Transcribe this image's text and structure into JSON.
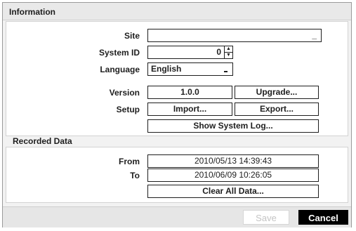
{
  "info": {
    "title": "Information",
    "site": {
      "label": "Site",
      "value": "_"
    },
    "system_id": {
      "label": "System ID",
      "value": "0"
    },
    "language": {
      "label": "Language",
      "value": "English"
    },
    "version": {
      "label": "Version",
      "value": "1.0.0",
      "upgrade_label": "Upgrade..."
    },
    "setup": {
      "label": "Setup",
      "import_label": "Import...",
      "export_label": "Export..."
    },
    "show_log_label": "Show System Log..."
  },
  "recorded": {
    "title": "Recorded Data",
    "from": {
      "label": "From",
      "value": "2010/05/13  14:39:43"
    },
    "to": {
      "label": "To",
      "value": "2010/06/09  10:26:05"
    },
    "clear_label": "Clear All Data..."
  },
  "footer": {
    "save_label": "Save",
    "cancel_label": "Cancel"
  },
  "icons": {
    "spin_up": "▲",
    "spin_down": "▼",
    "dropdown": "dropdown-marker-icon"
  }
}
